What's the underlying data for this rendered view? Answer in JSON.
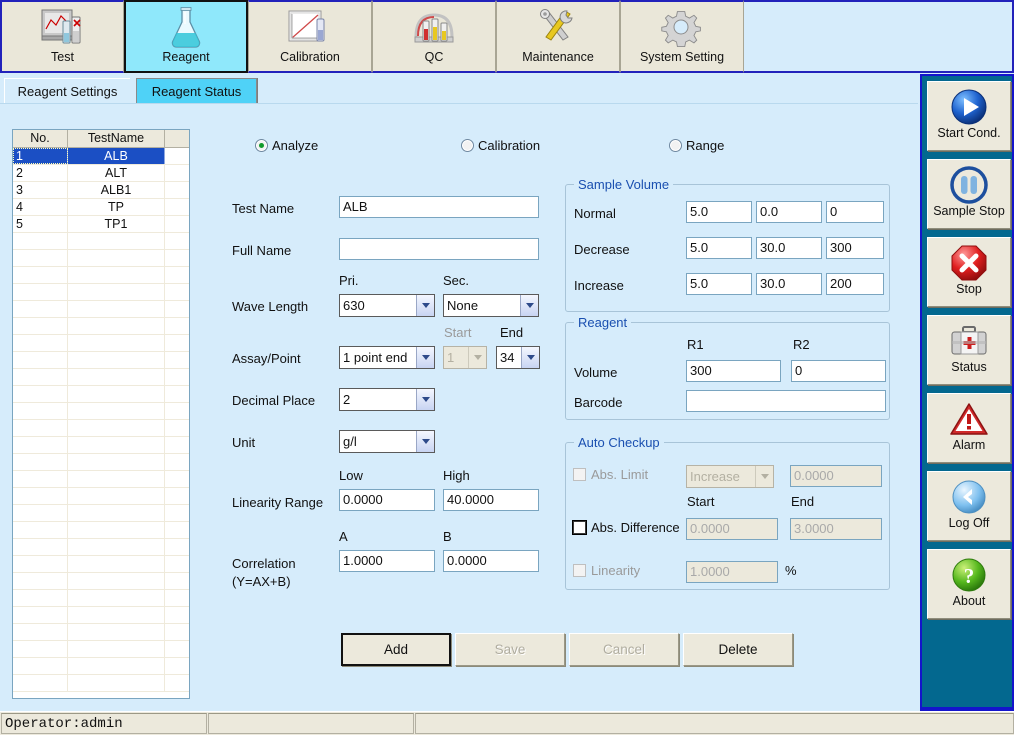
{
  "toolbar": {
    "items": [
      {
        "label": "Test",
        "icon": "chart-instrument-icon",
        "active": false
      },
      {
        "label": "Reagent",
        "icon": "flask-icon",
        "active": true
      },
      {
        "label": "Calibration",
        "icon": "calibration-graph-icon",
        "active": false
      },
      {
        "label": "QC",
        "icon": "test-tubes-icon",
        "active": false
      },
      {
        "label": "Maintenance",
        "icon": "tools-icon",
        "active": false
      },
      {
        "label": "System Setting",
        "icon": "gear-icon",
        "active": false
      }
    ]
  },
  "tabs": [
    {
      "label": "Reagent Settings",
      "selected": true
    },
    {
      "label": "Reagent Status",
      "selected": false
    }
  ],
  "grid": {
    "columns": [
      "No.",
      "TestName",
      ""
    ],
    "rows": [
      {
        "no": "1",
        "name": "ALB",
        "selected": true
      },
      {
        "no": "2",
        "name": "ALT",
        "selected": false
      },
      {
        "no": "3",
        "name": "ALB1",
        "selected": false
      },
      {
        "no": "4",
        "name": "TP",
        "selected": false
      },
      {
        "no": "5",
        "name": "TP1",
        "selected": false
      }
    ],
    "empty_rows": 27
  },
  "mode_radios": [
    {
      "label": "Analyze",
      "checked": true
    },
    {
      "label": "Calibration",
      "checked": false
    },
    {
      "label": "Range",
      "checked": false
    }
  ],
  "form": {
    "test_name_label": "Test Name",
    "test_name_value": "ALB",
    "full_name_label": "Full Name",
    "full_name_value": "",
    "wave_length_label": "Wave Length",
    "pri_label": "Pri.",
    "sec_label": "Sec.",
    "wave_pri_value": "630",
    "wave_sec_value": "None",
    "assay_point_label": "Assay/Point",
    "assay_value": "1 point end",
    "start_label": "Start",
    "end_label": "End",
    "point_start_value": "1",
    "point_end_value": "34",
    "decimal_place_label": "Decimal Place",
    "decimal_place_value": "2",
    "unit_label": "Unit",
    "unit_value": "g/l",
    "linearity_range_label": "Linearity Range",
    "low_label": "Low",
    "high_label": "High",
    "linearity_low": "0.0000",
    "linearity_high": "40.0000",
    "correlation_label": "Correlation",
    "correlation_label2": "(Y=AX+B)",
    "a_label": "A",
    "b_label": "B",
    "correlation_a": "1.0000",
    "correlation_b": "0.0000"
  },
  "sample_volume": {
    "title": "Sample Volume",
    "rows": [
      {
        "label": "Normal",
        "v1": "5.0",
        "v2": "0.0",
        "v3": "0"
      },
      {
        "label": "Decrease",
        "v1": "5.0",
        "v2": "30.0",
        "v3": "300"
      },
      {
        "label": "Increase",
        "v1": "5.0",
        "v2": "30.0",
        "v3": "200"
      }
    ]
  },
  "reagent": {
    "title": "Reagent",
    "r1_label": "R1",
    "r2_label": "R2",
    "volume_label": "Volume",
    "volume_r1": "300",
    "volume_r2": "0",
    "barcode_label": "Barcode",
    "barcode_value": ""
  },
  "auto_checkup": {
    "title": "Auto Checkup",
    "abs_limit_label": "Abs. Limit",
    "abs_limit_mode": "Increase",
    "abs_limit_value": "0.0000",
    "start_label": "Start",
    "end_label": "End",
    "abs_difference_label": "Abs. Difference",
    "abs_diff_start": "0.0000",
    "abs_diff_end": "3.0000",
    "linearity_label": "Linearity",
    "linearity_value": "1.0000",
    "percent_label": "%"
  },
  "action_buttons": [
    {
      "label": "Add",
      "state": "focused"
    },
    {
      "label": "Save",
      "state": "disabled"
    },
    {
      "label": "Cancel",
      "state": "disabled"
    },
    {
      "label": "Delete",
      "state": "normal"
    }
  ],
  "sidebar": {
    "items": [
      {
        "label": "Start Cond.",
        "icon": "play-icon"
      },
      {
        "label": "Sample Stop",
        "icon": "pause-icon"
      },
      {
        "label": "Stop",
        "icon": "stop-octagon-icon"
      },
      {
        "label": "Status",
        "icon": "first-aid-case-icon"
      },
      {
        "label": "Alarm",
        "icon": "warning-triangle-icon"
      },
      {
        "label": "Log Off",
        "icon": "back-arrow-icon"
      },
      {
        "label": "About",
        "icon": "question-mark-icon"
      }
    ]
  },
  "statusbar": {
    "operator": "Operator:admin",
    "cell2": "",
    "cell3": ""
  },
  "colors": {
    "background": "#d6ecfb",
    "toolbar_button": "#eae7d9",
    "toolbar_active": "#8fe8fb",
    "tab_inactive": "#4fd2f7",
    "sidebar_bg": "#03688f",
    "border_blue": "#1414cc",
    "grid_selection": "#1b4fc4",
    "group_title": "#1a4fb0"
  }
}
